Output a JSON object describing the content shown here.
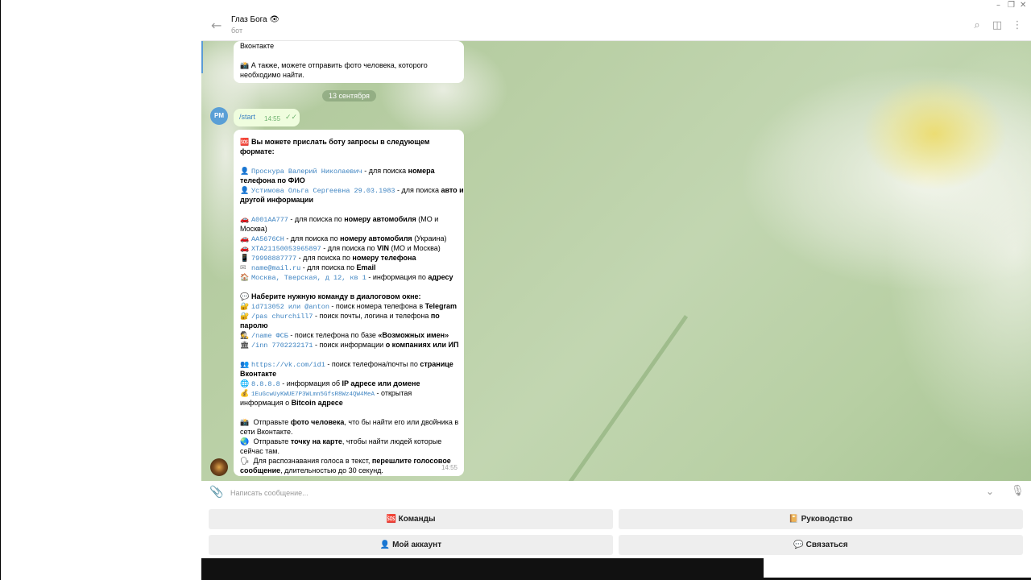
{
  "header": {
    "title": "Глаз Бога 👁",
    "subtitle": "бот"
  },
  "chat": {
    "top_bubble": {
      "line1": "Вконтакте",
      "line2": "📸 А также, можете отправить фото человека, которого",
      "line3": "необходимо найти."
    },
    "date_divider": "13 сентября",
    "user_avatar_initials": "PM",
    "outgoing": {
      "text": "/start",
      "time": "14:55"
    },
    "bot_message": {
      "time": "14:55",
      "intro_a": "Вы можете прислать боту запросы в следующем",
      "intro_b": "формате:",
      "r1_mono": "Проскура Валерий Николаевич",
      "r1_text": " - для поиска ",
      "r1_bold": "номера",
      "r1_bold2": "телефона по ФИО",
      "r2_mono": "Устимова Ольга Сергеевна 29.03.1983",
      "r2_text": " - для поиска ",
      "r2_bold": "авто и",
      "r2_bold2": "другой информации",
      "r3_mono": "А001АА777",
      "r3_text": " - для поиска по ",
      "r3_bold": "номеру автомобиля",
      "r3_tail": " (МО и",
      "r3_tail2": "Москва)",
      "r4_mono": "АА5676СН",
      "r4_text": " - для поиска по ",
      "r4_bold": "номеру автомобиля",
      "r4_tail": " (Украина)",
      "r5_mono": "XTA21150053965897",
      "r5_text": " - для поиска по ",
      "r5_bold": "VIN",
      "r5_tail": " (МО и Москва)",
      "r6_mono": "79998887777",
      "r6_text": " - для поиска по ",
      "r6_bold": "номеру телефона",
      "r7_mono": "name@mail.ru",
      "r7_text": " - для поиска по ",
      "r7_bold": "Email",
      "r8_mono": "Москва, Тверская, д 12, кв 1",
      "r8_text": " - информация по ",
      "r8_bold": "адресу",
      "cmd_head": "Наберите нужную команду в диалоговом окне:",
      "c1_mono": "id713052 или @anton",
      "c1_text": " - поиск номера телефона в ",
      "c1_bold": "Telegram",
      "c2_mono": "/pas churchill7",
      "c2_text": " - поиск почты, логина и телефона ",
      "c2_bold": "по",
      "c2_bold2": "паролю",
      "c3_mono": "/name ФСБ",
      "c3_text": " - поиск телефона по базе ",
      "c3_bold": "«Возможных имен»",
      "c4_mono": "/inn 7702232171",
      "c4_text": " - поиск информации ",
      "c4_bold": "о компаниях или ИП",
      "v1_mono": "https://vk.com/id1",
      "v1_text": " - поиск телефона/почты по ",
      "v1_bold": "странице",
      "v1_bold2": "Вконтакте",
      "v2_mono": "8.8.8.8",
      "v2_text": " - информация об ",
      "v2_bold": "IP адресе или домене",
      "v3_mono": "1EuGcwUyKWUE7P3WLmn5GfsR8Wz4QW4MeA",
      "v3_text": " - открытая",
      "v3_text2": "информация о ",
      "v3_bold": "Bitcoin адресе",
      "p1_text": " Отправьте ",
      "p1_bold": "фото человека",
      "p1_tail": ", что бы найти его или двойника в",
      "p1_tail2": "сети Вконтакте.",
      "p2_text": " Отправьте ",
      "p2_bold": "точку на карте",
      "p2_tail": ", чтобы найти людей которые",
      "p2_tail2": "сейчас там.",
      "p3_text": " Для распознавания голоса в текст, ",
      "p3_bold": "перешлите голосовое",
      "p3_bold2": "сообщение",
      "p3_tail": ", длительностью до 30 секунд."
    }
  },
  "input": {
    "placeholder": "Написать сообщение..."
  },
  "keyboard": {
    "commands": "🆘 Команды",
    "guide": "📔 Руководство",
    "account": "👤 Мой аккаунт",
    "contact": "💬 Связаться"
  },
  "icons": [
    "back-arrow-icon",
    "search-icon",
    "sidebar-icon",
    "more-vert-icon",
    "attach-icon",
    "chevron-down-icon",
    "mic-icon",
    "sos-icon",
    "person-icon",
    "car-icon",
    "phone-icon",
    "email-icon",
    "house-icon",
    "speech-icon",
    "lock-icon",
    "detective-icon",
    "building-icon",
    "users-icon",
    "globe-icon",
    "moneybag-icon",
    "camera-icon",
    "earth-icon",
    "speaking-head-icon"
  ]
}
